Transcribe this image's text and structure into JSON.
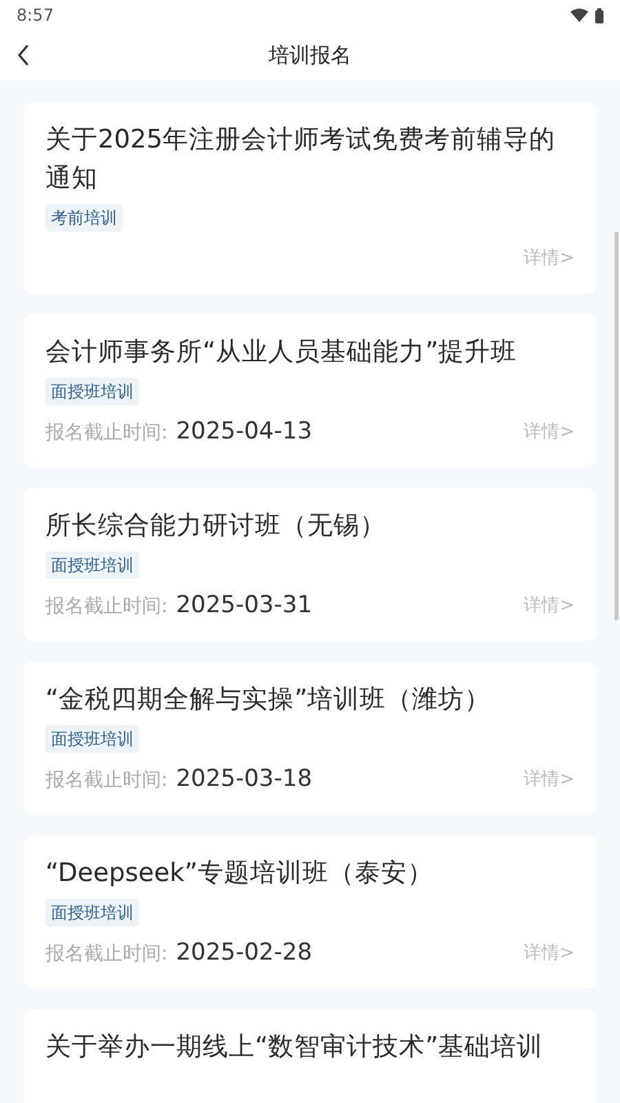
{
  "status_bar": {
    "time": "8:57"
  },
  "header": {
    "title": "培训报名"
  },
  "courses": [
    {
      "title": "关于2025年注册会计师考试免费考前辅导的通知",
      "tag": "考前培训",
      "detail": "详情>"
    },
    {
      "title": "会计师事务所“从业人员基础能力”提升班",
      "tag": "面授班培训",
      "deadline_label": "报名截止时间:",
      "deadline": "2025-04-13",
      "detail": "详情>"
    },
    {
      "title": "所长综合能力研讨班（无锡）",
      "tag": "面授班培训",
      "deadline_label": "报名截止时间:",
      "deadline": "2025-03-31",
      "detail": "详情>"
    },
    {
      "title": "“金税四期全解与实操”培训班（潍坊）",
      "tag": "面授班培训",
      "deadline_label": "报名截止时间:",
      "deadline": "2025-03-18",
      "detail": "详情>"
    },
    {
      "title": "“Deepseek”专题培训班（泰安）",
      "tag": "面授班培训",
      "deadline_label": "报名截止时间:",
      "deadline": "2025-02-28",
      "detail": "详情>"
    },
    {
      "title": "关于举办一期线上“数智审计技术”基础培训"
    }
  ]
}
